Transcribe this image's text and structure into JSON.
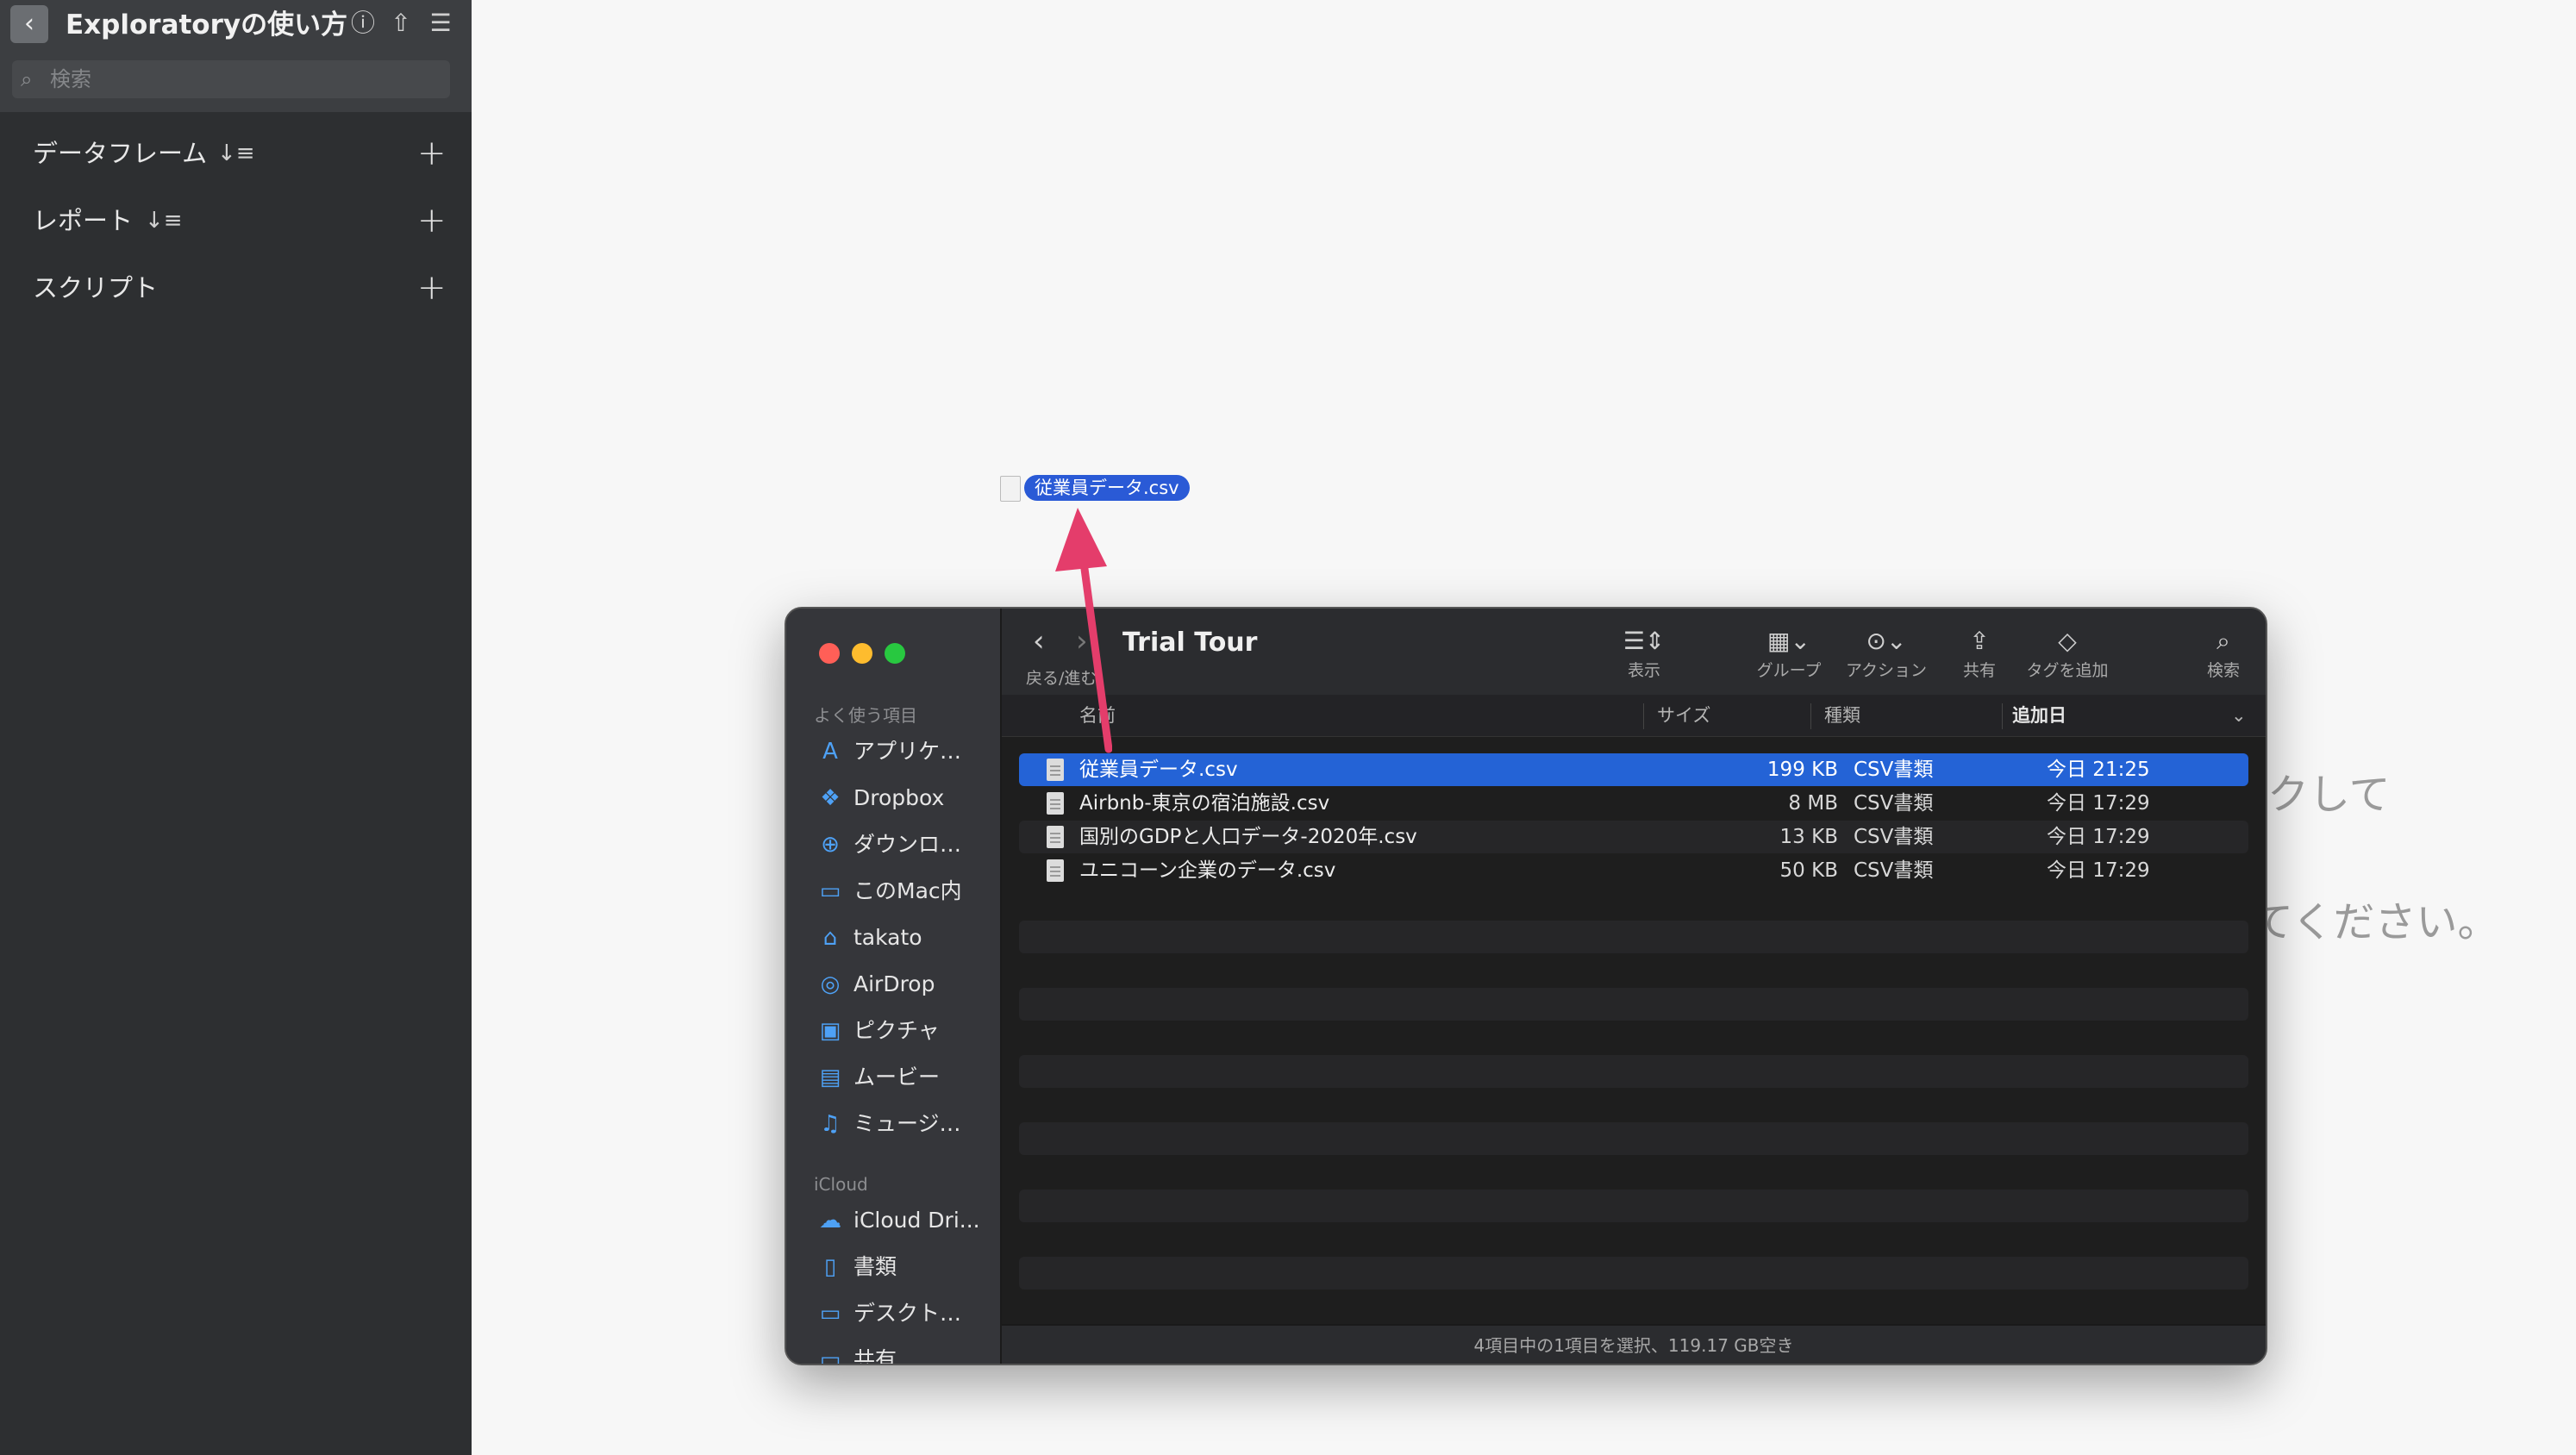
{
  "sidebar": {
    "back_glyph": "‹",
    "title": "Exploratoryの使い方",
    "icons": [
      "info-icon",
      "share-upload-icon",
      "menu-icon"
    ],
    "search_placeholder": "検索",
    "sections": [
      {
        "label": "データフレーム",
        "sortable": true
      },
      {
        "label": "レポート",
        "sortable": true
      },
      {
        "label": "スクリプト",
        "sortable": false
      }
    ]
  },
  "background_hint": {
    "line1": "クして",
    "line2": "てください。"
  },
  "drag": {
    "label": "従業員データ.csv"
  },
  "finder": {
    "title": "Trial Tour",
    "nav_label": "戻る/進む",
    "toolbar": [
      {
        "label": "表示",
        "icon": "list-view-icon"
      },
      {
        "label": "グループ",
        "icon": "group-icon"
      },
      {
        "label": "アクション",
        "icon": "action-icon"
      },
      {
        "label": "共有",
        "icon": "share-icon"
      },
      {
        "label": "タグを追加",
        "icon": "tag-icon"
      },
      {
        "label": "検索",
        "icon": "search-icon"
      }
    ],
    "sidebar": {
      "favorites_label": "よく使う項目",
      "favorites": [
        {
          "label": "アプリケ…",
          "icon": "applications-icon"
        },
        {
          "label": "Dropbox",
          "icon": "dropbox-icon"
        },
        {
          "label": "ダウンロ…",
          "icon": "downloads-icon"
        },
        {
          "label": "このMac内",
          "icon": "folder-icon"
        },
        {
          "label": "takato",
          "icon": "home-icon"
        },
        {
          "label": "AirDrop",
          "icon": "airdrop-icon"
        },
        {
          "label": "ピクチャ",
          "icon": "pictures-icon"
        },
        {
          "label": "ムービー",
          "icon": "movies-icon"
        },
        {
          "label": "ミュージ…",
          "icon": "music-icon"
        }
      ],
      "icloud_label": "iCloud",
      "icloud": [
        {
          "label": "iCloud Dri...",
          "icon": "icloud-icon"
        },
        {
          "label": "書類",
          "icon": "documents-icon"
        },
        {
          "label": "デスクト…",
          "icon": "desktop-icon"
        },
        {
          "label": "共有",
          "icon": "shared-folder-icon"
        }
      ]
    },
    "columns": {
      "name": "名前",
      "size": "サイズ",
      "kind": "種類",
      "date": "追加日"
    },
    "files": [
      {
        "name": "従業員データ.csv",
        "size": "199 KB",
        "kind": "CSV書類",
        "date": "今日 21:25",
        "selected": true
      },
      {
        "name": "Airbnb-東京の宿泊施設.csv",
        "size": "8 MB",
        "kind": "CSV書類",
        "date": "今日 17:29",
        "selected": false
      },
      {
        "name": "国別のGDPと人口データ-2020年.csv",
        "size": "13 KB",
        "kind": "CSV書類",
        "date": "今日 17:29",
        "selected": false
      },
      {
        "name": "ユニコーン企業のデータ.csv",
        "size": "50 KB",
        "kind": "CSV書類",
        "date": "今日 17:29",
        "selected": false
      }
    ],
    "status": "4項目中の1項目を選択、119.17 GB空き"
  },
  "colors": {
    "selection": "#2463d6",
    "arrow": "#e43d6b",
    "traffic_red": "#ff5f57",
    "traffic_yellow": "#febc2e",
    "traffic_green": "#28c840"
  }
}
